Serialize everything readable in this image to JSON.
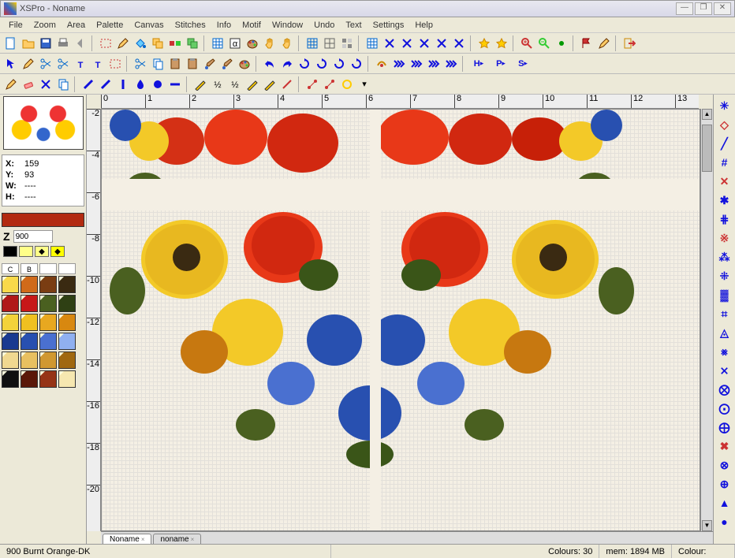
{
  "title": "XSPro - Noname",
  "window_buttons": {
    "min": "—",
    "max": "❐",
    "close": "✕"
  },
  "menus": [
    "File",
    "Zoom",
    "Area",
    "Palette",
    "Canvas",
    "Stitches",
    "Info",
    "Motif",
    "Window",
    "Undo",
    "Text",
    "Settings",
    "Help"
  ],
  "coords": {
    "x_label": "X:",
    "x": "159",
    "y_label": "Y:",
    "y": "93",
    "w_label": "W:",
    "w": "----",
    "h_label": "H:",
    "h": "----"
  },
  "thread": {
    "z": "Z",
    "code": "900"
  },
  "current_color": "#b22a10",
  "markers": [
    "◆",
    "",
    "◆",
    "◆"
  ],
  "marker_colors": [
    "#000",
    "#ff8",
    "#ff8",
    "#ff0"
  ],
  "palette_headers": [
    "C",
    "B",
    "",
    ""
  ],
  "palette": [
    "#f9d94a",
    "#d06a1a",
    "#7a3d12",
    "#3a2a12",
    "#b01818",
    "#c71818",
    "#4a6020",
    "#2f4014",
    "#f3d33a",
    "#f0c020",
    "#e8a820",
    "#d88810",
    "#1a3a90",
    "#2850b0",
    "#4a70d0",
    "#90b0f0",
    "#f0d890",
    "#e8c060",
    "#d09830",
    "#a06810",
    "#101010",
    "#5a1808",
    "#963416",
    "#f6e7b0"
  ],
  "ruler_h": [
    "0",
    "1",
    "2",
    "3",
    "4",
    "5",
    "6",
    "7",
    "8",
    "9",
    "10",
    "11",
    "12",
    "13"
  ],
  "ruler_v": [
    "-2",
    "-4",
    "-6",
    "-8",
    "-10",
    "-12",
    "-14",
    "-16",
    "-18",
    "-20"
  ],
  "tabs": [
    {
      "label": "Noname",
      "active": true
    },
    {
      "label": "noname",
      "active": false
    }
  ],
  "status": {
    "thread": "900 Burnt Orange-DK",
    "colours_label": "Colours:",
    "colours": "30",
    "mem_label": "mem:",
    "mem": "1894 MB",
    "colour_label": "Colour:"
  },
  "stitch_glyphs": [
    "✳",
    "◇",
    "╱",
    "#",
    "✕",
    "✱",
    "⋕",
    "※",
    "⁂",
    "⁜",
    "▓",
    "⌗",
    "◬",
    "⨳",
    "⨯",
    "⨂",
    "⨀",
    "⨁",
    "✖",
    "⊗",
    "⊕",
    "▲",
    "●"
  ]
}
